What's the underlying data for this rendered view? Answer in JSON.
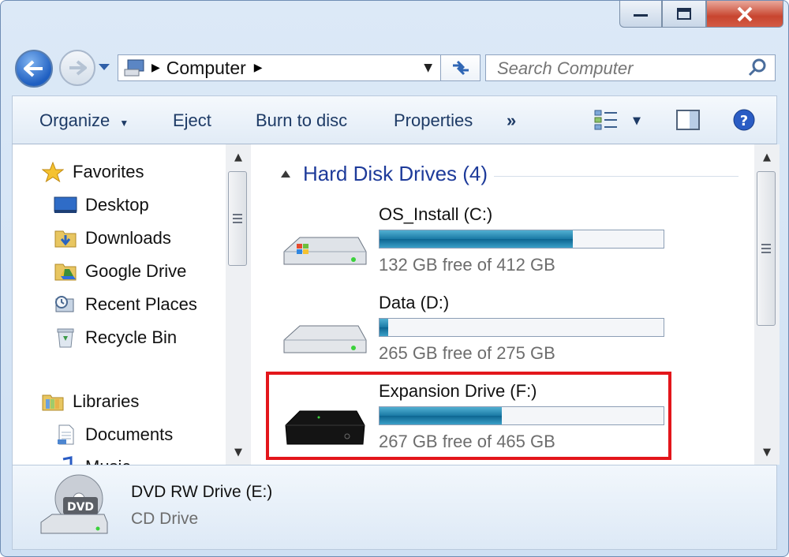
{
  "address": {
    "location": "Computer"
  },
  "search": {
    "placeholder": "Search Computer"
  },
  "toolbar": {
    "organize": "Organize",
    "eject": "Eject",
    "burn": "Burn to disc",
    "properties": "Properties",
    "more": "»"
  },
  "nav": {
    "favorites": "Favorites",
    "items": [
      "Desktop",
      "Downloads",
      "Google Drive",
      "Recent Places",
      "Recycle Bin"
    ],
    "libraries": "Libraries",
    "lib_items": [
      "Documents",
      "Music"
    ]
  },
  "group": {
    "label": "Hard Disk Drives (4)"
  },
  "drives": [
    {
      "name": "OS_Install (C:)",
      "free": "132 GB free of 412 GB",
      "used_fraction": 0.68
    },
    {
      "name": "Data (D:)",
      "free": "265 GB free of 275 GB",
      "used_fraction": 0.03
    },
    {
      "name": "Expansion Drive (F:)",
      "free": "267 GB free of 465 GB",
      "used_fraction": 0.43
    }
  ],
  "details": {
    "name": "DVD RW Drive (E:)",
    "type": "CD Drive",
    "badge": "DVD"
  },
  "colors": {
    "highlight": "#e3161b",
    "accent": "#1e3b9a"
  }
}
